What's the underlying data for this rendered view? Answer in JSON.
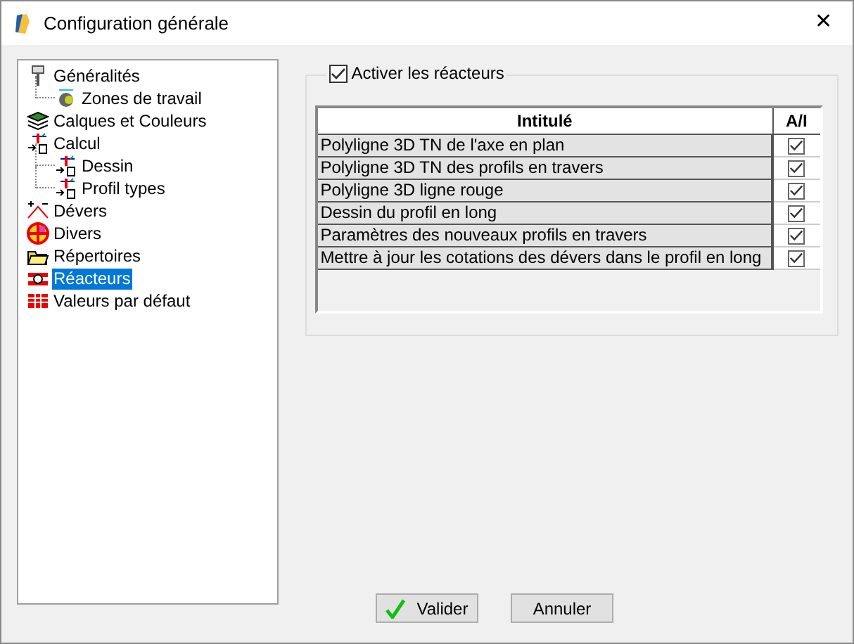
{
  "window": {
    "title": "Configuration générale",
    "close": "✕"
  },
  "tree": [
    {
      "label": "Généralités",
      "kind": "pin",
      "selected": false,
      "children": [
        {
          "label": "Zones de travail",
          "kind": "zone",
          "selected": false
        }
      ]
    },
    {
      "label": "Calques et Couleurs",
      "kind": "layers",
      "selected": false
    },
    {
      "label": "Calcul",
      "kind": "calc",
      "selected": false,
      "children": [
        {
          "label": "Dessin",
          "kind": "calc",
          "selected": false
        },
        {
          "label": "Profil types",
          "kind": "calc",
          "selected": false
        }
      ]
    },
    {
      "label": "Dévers",
      "kind": "slope",
      "selected": false
    },
    {
      "label": "Divers",
      "kind": "ball",
      "selected": false
    },
    {
      "label": "Répertoires",
      "kind": "folder",
      "selected": false
    },
    {
      "label": "Réacteurs",
      "kind": "reactor",
      "selected": true
    },
    {
      "label": "Valeurs par défaut",
      "kind": "grid",
      "selected": false
    }
  ],
  "activate": {
    "label": "Activer les réacteurs",
    "checked": true
  },
  "table": {
    "columns": [
      "Intitulé",
      "A/I"
    ],
    "rows": [
      {
        "label": "Polyligne 3D TN de l'axe en plan",
        "checked": true
      },
      {
        "label": "Polyligne 3D TN des profils en travers",
        "checked": true
      },
      {
        "label": "Polyligne 3D ligne rouge",
        "checked": true
      },
      {
        "label": "Dessin du profil en long",
        "checked": true
      },
      {
        "label": "Paramètres des nouveaux profils en travers",
        "checked": true
      },
      {
        "label": "Mettre à jour les cotations des dévers dans le profil en long",
        "checked": true
      }
    ]
  },
  "buttons": [
    {
      "label": "Valider",
      "kind": "ok"
    },
    {
      "label": "Annuler",
      "kind": "plain"
    }
  ]
}
